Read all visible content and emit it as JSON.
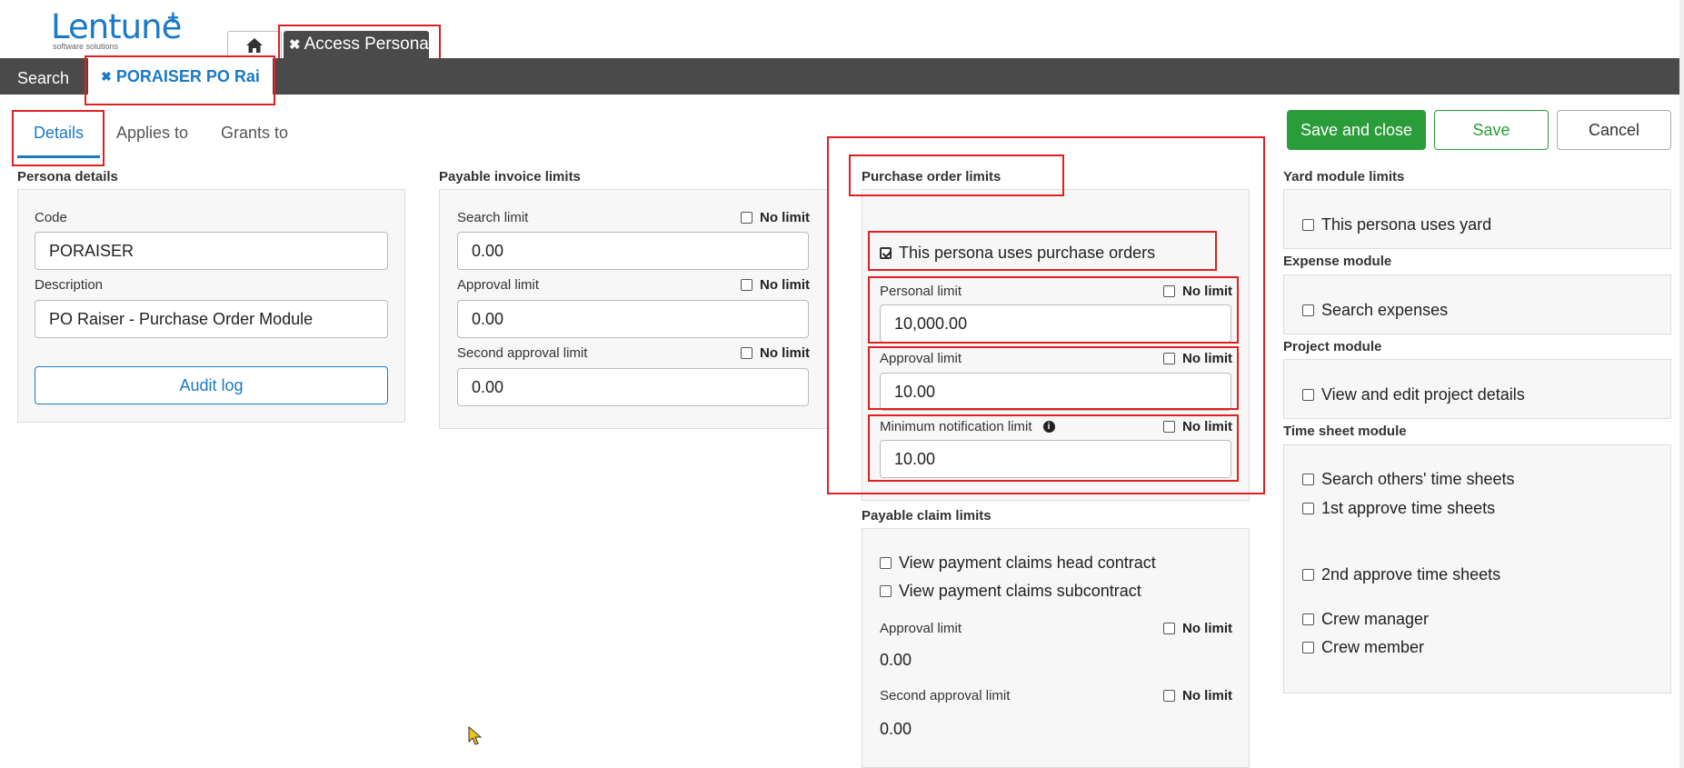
{
  "logo": {
    "name": "Lentune",
    "tagline": "software solutions"
  },
  "window_tabs": {
    "active_tab_label": "Access Persona"
  },
  "nav": {
    "search_label": "Search",
    "record_tab_label": "PORAISER PO Rai"
  },
  "subtabs": [
    "Details",
    "Applies to",
    "Grants to"
  ],
  "actions": {
    "save_close": "Save and close",
    "save": "Save",
    "cancel": "Cancel"
  },
  "persona_details": {
    "title": "Persona details",
    "code_label": "Code",
    "code_value": "PORAISER",
    "description_label": "Description",
    "description_value": "PO Raiser - Purchase Order Module",
    "audit_log_label": "Audit log"
  },
  "payable_invoice": {
    "title": "Payable invoice limits",
    "no_limit": "No limit",
    "search_label": "Search limit",
    "search_value": "0.00",
    "approval_label": "Approval limit",
    "approval_value": "0.00",
    "second_label": "Second approval limit",
    "second_value": "0.00"
  },
  "purchase_order": {
    "title": "Purchase order limits",
    "uses_po_label": "This persona uses purchase orders",
    "uses_po_checked": true,
    "no_limit": "No limit",
    "personal_label": "Personal limit",
    "personal_value": "10,000.00",
    "approval_label": "Approval limit",
    "approval_value": "10.00",
    "min_notif_label": "Minimum notification limit",
    "min_notif_value": "10.00"
  },
  "payable_claim": {
    "title": "Payable claim limits",
    "head_contract_label": "View payment claims head contract",
    "subcontract_label": "View payment claims subcontract",
    "no_limit": "No limit",
    "approval_label": "Approval limit",
    "approval_value": "0.00",
    "second_label": "Second approval limit",
    "second_value": "0.00"
  },
  "yard": {
    "title": "Yard module limits",
    "option": "This persona uses yard"
  },
  "expense": {
    "title": "Expense module",
    "option": "Search expenses"
  },
  "project": {
    "title": "Project module",
    "option": "View and edit project details"
  },
  "timesheet": {
    "title": "Time sheet module",
    "options": [
      "Search others' time sheets",
      "1st approve time sheets",
      "2nd approve time sheets",
      "Crew manager",
      "Crew member"
    ]
  },
  "colors": {
    "brand": "#1a7ac7",
    "success": "#2a9c3a",
    "annotation": "#e02020",
    "topbar": "#4a4a4a"
  }
}
